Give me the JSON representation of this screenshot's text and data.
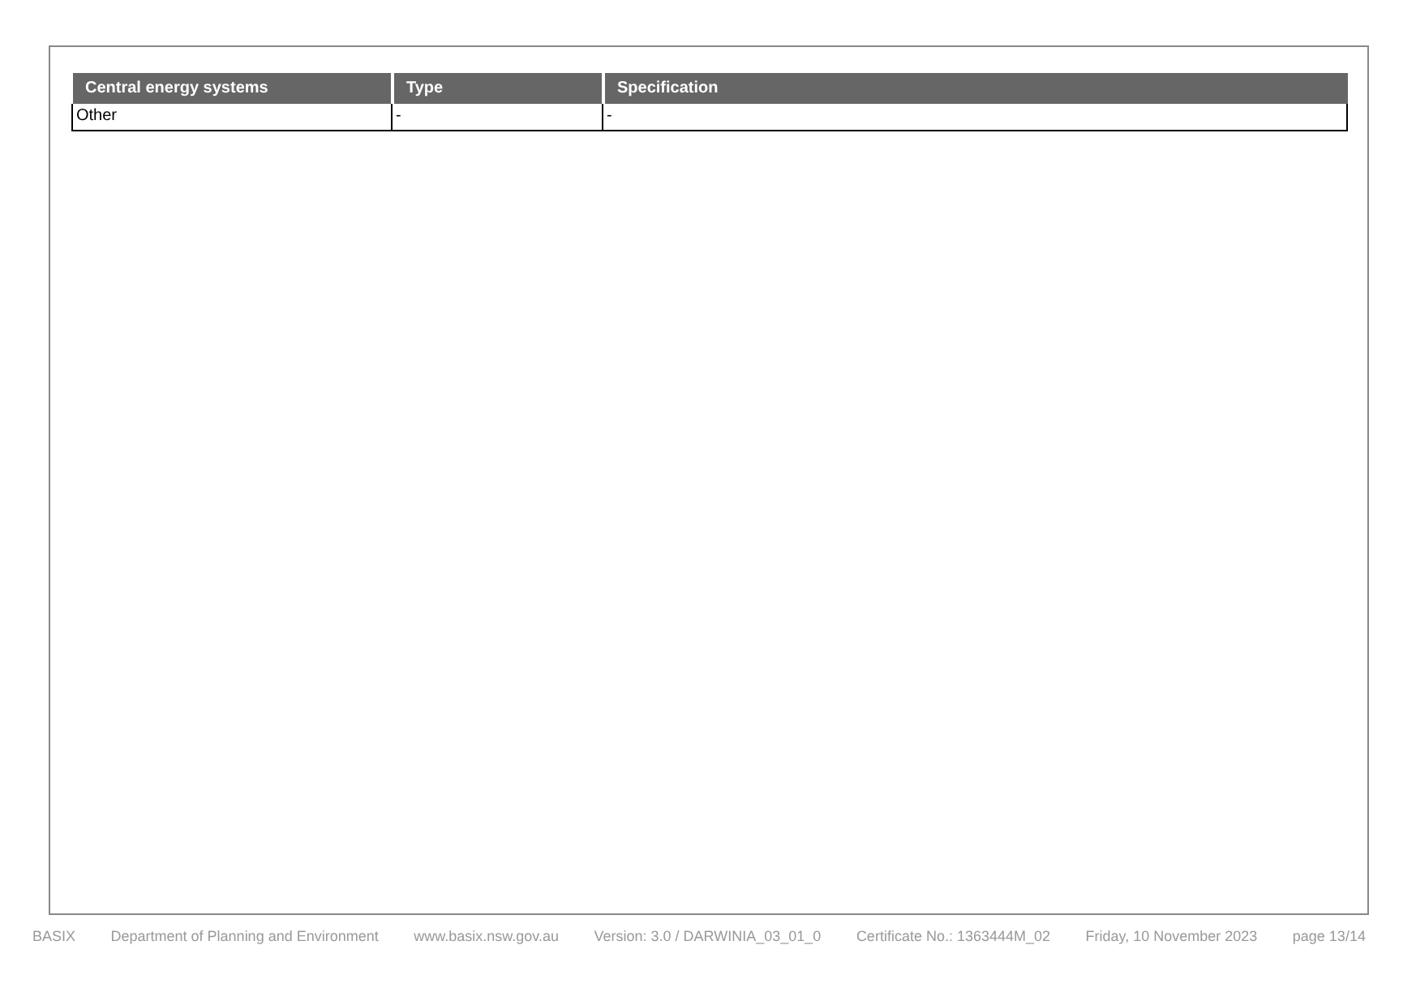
{
  "table": {
    "columns": [
      "Central energy systems",
      "Type",
      "Specification"
    ],
    "rows": [
      [
        "Other",
        "-",
        "-"
      ]
    ]
  },
  "footer": [
    "BASIX",
    "Department of Planning and Environment",
    "www.basix.nsw.gov.au",
    "Version: 3.0 / DARWINIA_03_01_0",
    "Certificate No.: 1363444M_02",
    "Friday, 10 November 2023",
    "page 13/14"
  ]
}
